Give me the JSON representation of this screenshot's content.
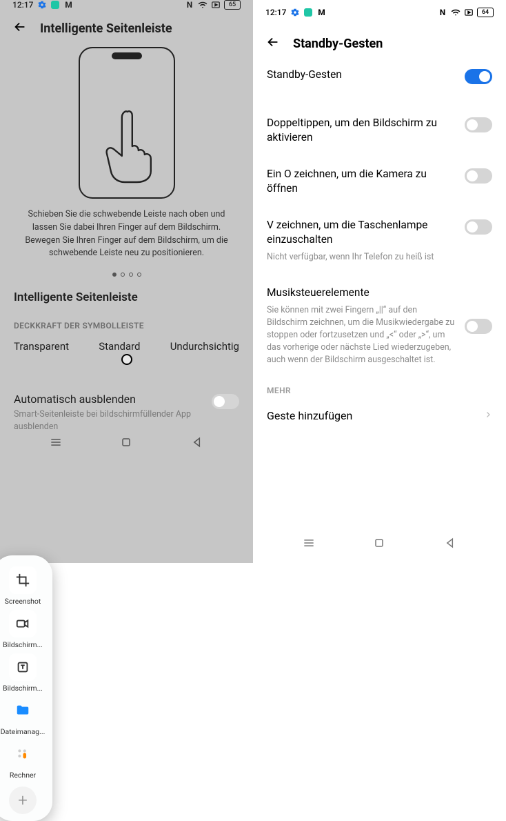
{
  "left": {
    "status": {
      "time": "12:17",
      "battery": "65"
    },
    "title": "Intelligente Seitenleiste",
    "caption": "Schieben Sie die schwebende Leiste nach oben und lassen Sie dabei Ihren Finger auf dem Bildschirm. Bewegen Sie Ihren Finger auf dem Bildschirm, um die schwebende Leiste neu zu positionieren.",
    "section": "Intelligente Seitenleiste",
    "opacity_header": "DECKKRAFT DER SYMBOLLEISTE",
    "opacity": {
      "a": "Transparent",
      "b": "Standard",
      "c": "Undurchsichtig"
    },
    "autohide": {
      "title": "Automatisch ausblenden",
      "sub": "Smart-Seitenleiste bei bildschirmfüllender App ausblenden"
    },
    "floatbar": {
      "items": {
        "screenshot": "Screenshot",
        "screenrec": "Bildschirm...",
        "screentrans": "Bildschirm...",
        "files": "Dateimanag...",
        "calc": "Rechner"
      }
    }
  },
  "right": {
    "status": {
      "time": "12:17",
      "battery": "64"
    },
    "title": "Standby-Gesten",
    "master": "Standby-Gesten",
    "items": {
      "double_tap": "Doppeltippen, um den Bildschirm zu aktivieren",
      "draw_o": "Ein O zeichnen, um die Kamera zu öffnen",
      "draw_v": "V zeichnen, um die Taschenlampe einzuschalten",
      "draw_v_sub": "Nicht verfügbar, wenn Ihr Telefon zu heiß ist",
      "music": "Musiksteuerelemente",
      "music_sub": "Sie können mit zwei Fingern „||“ auf den Bildschirm zeichnen, um die Musikwiedergabe zu stoppen oder fortzusetzen und „<“ oder „>“, um das vorherige oder nächste Lied wiederzugeben, auch wenn der Bildschirm ausgeschaltet ist."
    },
    "more_header": "MEHR",
    "add_gesture": "Geste hinzufügen"
  }
}
